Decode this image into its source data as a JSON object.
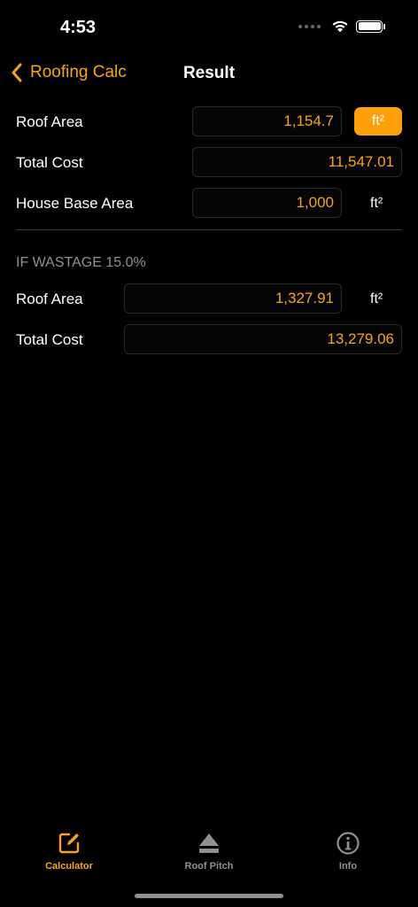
{
  "status_bar": {
    "time": "4:53"
  },
  "nav": {
    "back_label": "Roofing Calc",
    "title": "Result"
  },
  "results": {
    "roof_area": {
      "label": "Roof Area",
      "value": "1,154.7",
      "unit": "ft²"
    },
    "total_cost": {
      "label": "Total Cost",
      "value": "11,547.01"
    },
    "house_base_area": {
      "label": "House Base Area",
      "value": "1,000",
      "unit": "ft²"
    }
  },
  "wastage": {
    "header": "IF WASTAGE 15.0%",
    "roof_area": {
      "label": "Roof Area",
      "value": "1,327.91",
      "unit": "ft²"
    },
    "total_cost": {
      "label": "Total Cost",
      "value": "13,279.06"
    }
  },
  "tabs": [
    {
      "label": "Calculator",
      "icon": "compose-icon",
      "active": true
    },
    {
      "label": "Roof Pitch",
      "icon": "eject-icon",
      "active": false
    },
    {
      "label": "Info",
      "icon": "info-icon",
      "active": false
    }
  ],
  "colors": {
    "accent": "#f7a21b",
    "background": "#000000",
    "inactive": "#8e8e93"
  }
}
